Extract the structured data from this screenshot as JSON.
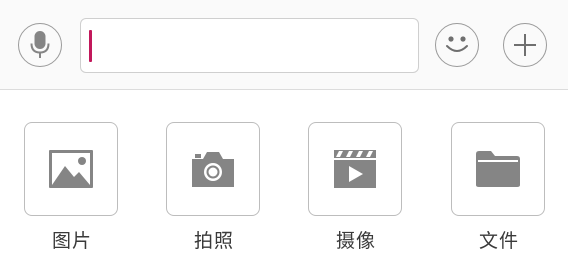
{
  "input_bar": {
    "voice_icon": "microphone-icon",
    "emoji_icon": "smiley-face-icon",
    "more_icon": "plus-icon",
    "text_value": "",
    "caret_color": "#c2185b"
  },
  "actions": [
    {
      "label": "图片",
      "icon": "image-icon"
    },
    {
      "label": "拍照",
      "icon": "camera-icon"
    },
    {
      "label": "摄像",
      "icon": "video-clapper-icon"
    },
    {
      "label": "文件",
      "icon": "folder-icon"
    }
  ],
  "colors": {
    "icon_gray": "#858585",
    "border_gray": "#bdbdbd",
    "accent": "#c2185b"
  }
}
